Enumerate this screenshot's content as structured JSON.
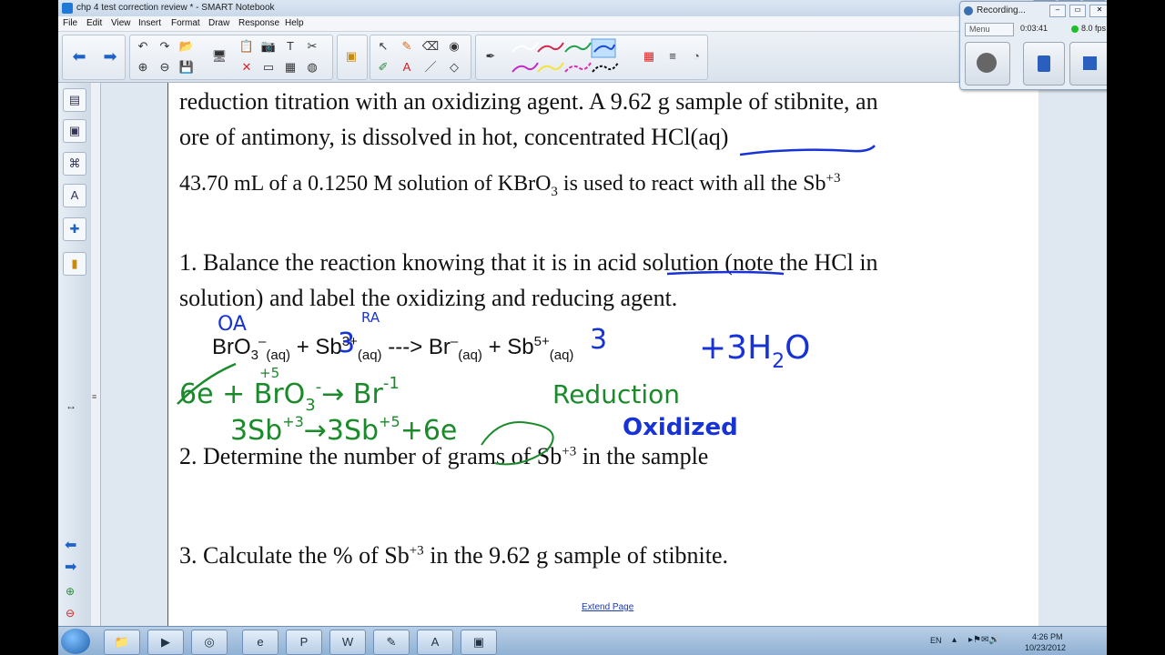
{
  "window": {
    "title": "chp 4 test correction review * - SMART Notebook",
    "minimize": "–",
    "maximize": "□",
    "close": "✕"
  },
  "menu": [
    "File",
    "Edit",
    "View",
    "Insert",
    "Format",
    "Draw",
    "Response",
    "Help"
  ],
  "recording": {
    "title": "Recording...",
    "menu_label": "Menu",
    "time": "0:03:41",
    "fps": "8.0 fps"
  },
  "page": {
    "line1": "reduction titration with an oxidizing agent. A 9.62 g sample of stibnite, an",
    "line2": "ore of antimony, is dissolved in hot, concentrated HCl(aq)",
    "line3_a": "43.70 mL of a 0.1250 M solution of KBrO",
    "line3_sub": "3",
    "line3_b": " is used to react with all the Sb",
    "line3_sup": "+3",
    "q1_line1": "1.  Balance the reaction knowing that it is in acid solution (note the HCl in",
    "q1_line2": "solution) and label the oxidizing and reducing agent.",
    "eq": {
      "bro3": "BrO",
      "bro3_sub": "3",
      "bro3_sup": "–",
      "aq": "(aq)",
      "plus": " + ",
      "sb": "Sb",
      "sb3_sup": "3+",
      "arrow": " ---> ",
      "br": "Br",
      "br_sup": "–",
      "sb5_sup": "5+"
    },
    "q2_a": "2.  Determine the number of grams of Sb",
    "q2_sup": "+3",
    "q2_b": " in the sample",
    "q3_a": "3.  Calculate the % of Sb",
    "q3_sup": "+3",
    "q3_b": "  in the 9.62 g sample of stibnite.",
    "extend_page": "Extend Page"
  },
  "handwriting": {
    "oa": "OA",
    "ra": "RA",
    "coef3a": "3",
    "coef3b": "3",
    "water": "+3H",
    "water_sub": "2",
    "water_o": "O",
    "half1": "6e + BrO",
    "half1_sub": "3",
    "half1_sup": "-",
    "half1_arrow": "→ Br",
    "half1_br_sup": "-1",
    "plus5": "+5",
    "reduction": "Reduction",
    "half2": "3Sb",
    "half2_sup": "+3",
    "half2_arrow": "→3Sb",
    "half2_sup2": "+5",
    "half2_e": "+6e",
    "oxidized": "Oxidized",
    "minus1": "-1",
    "blue": "#1733d6",
    "green": "#1a8a2a"
  },
  "taskbar": {
    "lang": "EN",
    "time": "4:26 PM",
    "date": "10/23/2012"
  }
}
